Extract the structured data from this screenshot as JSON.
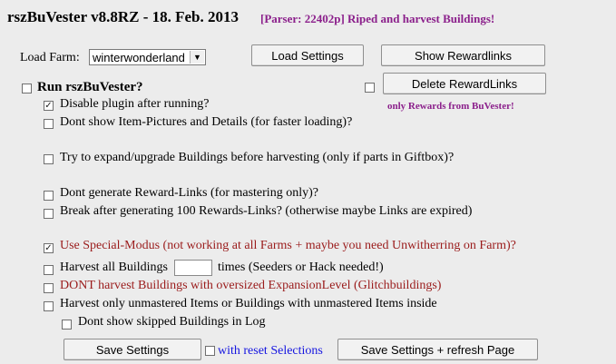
{
  "header": {
    "title": "rszBuVester v8.8RZ - 18. Feb. 2013",
    "parser_note": "[Parser: 22402p] Riped and harvest Buildings!"
  },
  "load_farm": {
    "label": "Load Farm:",
    "selected": "winterwonderland"
  },
  "buttons": {
    "load_settings": "Load Settings",
    "show_rewardlinks": "Show Rewardlinks",
    "delete_rewardlinks": "Delete RewardLinks",
    "save_settings": "Save Settings",
    "save_refresh": "Save Settings + refresh Page"
  },
  "only_rewards_note": "only Rewards from BuVester!",
  "run_label": "Run rszBuVester?",
  "options": {
    "disable_plugin": "Disable plugin after running?",
    "dont_show_pictures": "Dont show Item-Pictures and Details (for faster loading)?",
    "expand_upgrade": "Try to expand/upgrade Buildings before harvesting (only if parts in Giftbox)?",
    "dont_generate_links": "Dont generate Reward-Links (for mastering only)?",
    "break_after_100": "Break after generating 100 Rewards-Links? (otherwise maybe Links are expired)",
    "special_modus": "Use Special-Modus (not working at all Farms + maybe you need Unwitherring on Farm)?",
    "harvest_all_prefix": "Harvest all Buildings",
    "harvest_all_suffix": "times (Seeders or Hack needed!)",
    "dont_harvest_oversized": "DONT harvest Buildings with oversized ExpansionLevel (Glitchbuildings)",
    "harvest_unmastered": "Harvest only unmastered Items or Buildings with unmastered Items inside",
    "dont_show_skipped": "Dont show skipped Buildings in Log"
  },
  "reset_selections": "with reset Selections",
  "check_mark": "✓"
}
